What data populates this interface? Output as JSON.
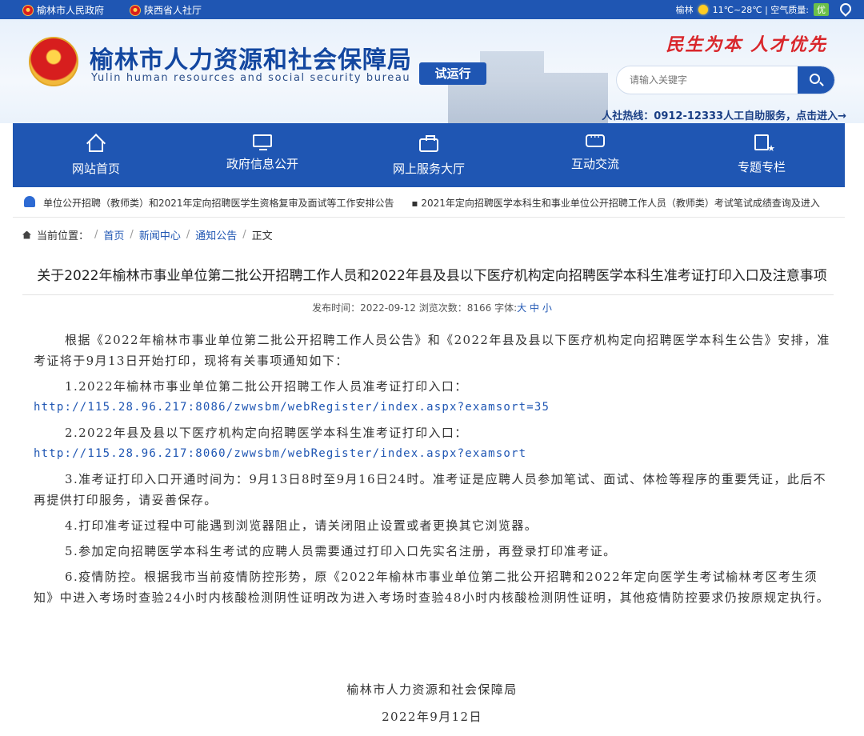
{
  "topbar": {
    "links": [
      "榆林市人民政府",
      "陕西省人社厅"
    ],
    "city": "榆林",
    "weather": "11℃~28℃ | 空气质量:",
    "air_quality": "优"
  },
  "header": {
    "title": "榆林市人力资源和社会保障局",
    "subtitle": "Yulin human resources and social security bureau",
    "badge": "试运行",
    "slogan": "民生为本  人才优先",
    "search_placeholder": "请输入关键字",
    "hotline": "人社热线：0912-12333人工自助服务，点击进入→"
  },
  "nav": {
    "items": [
      {
        "label": "网站首页",
        "icon": "home-icon"
      },
      {
        "label": "政府信息公开",
        "icon": "screen-icon"
      },
      {
        "label": "网上服务大厅",
        "icon": "briefcase-icon"
      },
      {
        "label": "互动交流",
        "icon": "chat-icon"
      },
      {
        "label": "专题专栏",
        "icon": "document-star-icon"
      }
    ]
  },
  "ticker": {
    "items": [
      "单位公开招聘（教师类）和2021年定向招聘医学生资格复审及面试等工作安排公告",
      "▪ 2021年定向招聘医学本科生和事业单位公开招聘工作人员（教师类）考试笔试成绩查询及进入"
    ]
  },
  "breadcrumb": {
    "label": "当前位置：",
    "items": [
      "首页",
      "新闻中心",
      "通知公告",
      "正文"
    ]
  },
  "article": {
    "title": "关于2022年榆林市事业单位第二批公开招聘工作人员和2022年县及县以下医疗机构定向招聘医学本科生准考证打印入口及注意事项",
    "meta_prefix": "发布时间：2022-09-12 浏览次数：8166 字体:",
    "font_sizes": [
      "大",
      "中",
      "小"
    ],
    "intro": "根据《2022年榆林市事业单位第二批公开招聘工作人员公告》和《2022年县及县以下医疗机构定向招聘医学本科生公告》安排，准考证将于9月13日开始打印，现将有关事项通知如下：",
    "item1": "1.2022年榆林市事业单位第二批公开招聘工作人员准考证打印入口：",
    "url1": "http://115.28.96.217:8086/zwwsbm/webRegister/index.aspx?examsort=35",
    "item2": "2.2022年县及县以下医疗机构定向招聘医学本科生准考证打印入口：",
    "url2": "http://115.28.96.217:8060/zwwsbm/webRegister/index.aspx?examsort",
    "item3": "3.准考证打印入口开通时间为：9月13日8时至9月16日24时。准考证是应聘人员参加笔试、面试、体检等程序的重要凭证，此后不再提供打印服务，请妥善保存。",
    "item4": "4.打印准考证过程中可能遇到浏览器阻止，请关闭阻止设置或者更换其它浏览器。",
    "item5": "5.参加定向招聘医学本科生考试的应聘人员需要通过打印入口先实名注册，再登录打印准考证。",
    "item6": "6.疫情防控。根据我市当前疫情防控形势，原《2022年榆林市事业单位第二批公开招聘和2022年定向医学生考试榆林考区考生须知》中进入考场时查验24小时内核酸检测阴性证明改为进入考场时查验48小时内核酸检测阴性证明，其他疫情防控要求仍按原规定执行。",
    "signature": "榆林市人力资源和社会保障局",
    "date": "2022年9月12日"
  }
}
